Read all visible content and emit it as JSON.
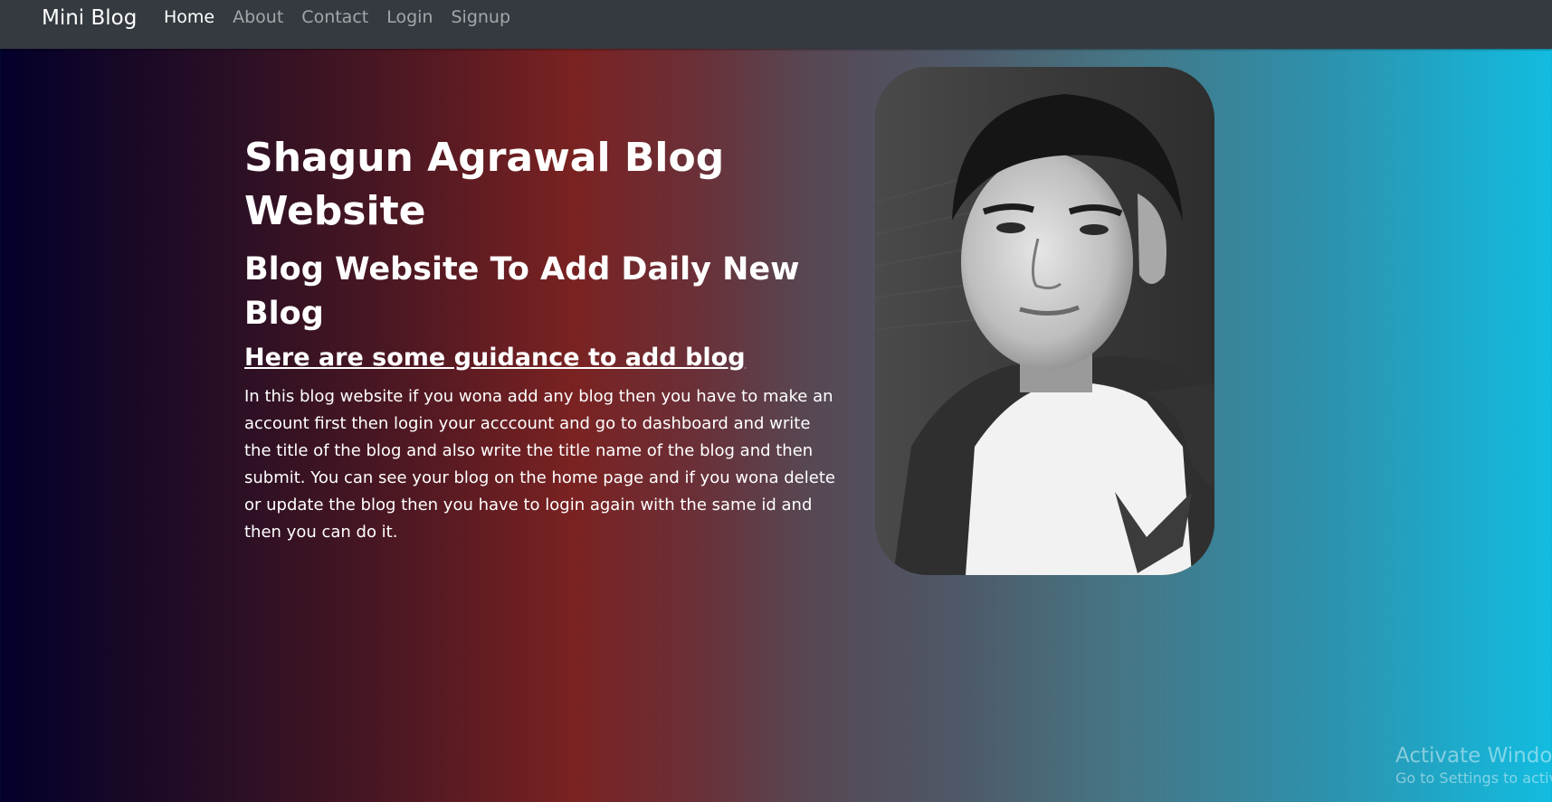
{
  "navbar": {
    "brand": "Mini Blog",
    "links": [
      {
        "label": "Home",
        "active": true
      },
      {
        "label": "About",
        "active": false
      },
      {
        "label": "Contact",
        "active": false
      },
      {
        "label": "Login",
        "active": false
      },
      {
        "label": "Signup",
        "active": false
      }
    ]
  },
  "hero": {
    "title": "Shagun Agrawal Blog Website",
    "subtitle": "Blog Website To Add Daily New Blog",
    "guidance_heading": "Here are some guidance to add blog",
    "guidance_text": "In this blog website if you wona add any blog then you have to make an account first then login your acccount and go to dashboard and write the title of the blog and also write the title name of the blog and then submit. You can see your blog on the home page and if you wona delete or update the blog then you have to login again with the same id and then you can do it."
  },
  "watermark": {
    "title": "Activate Window",
    "subtitle": "Go to Settings to activ"
  },
  "colors": {
    "navbar_bg": "#343a40",
    "gradient_start": "#03002a",
    "gradient_mid": "#7a2222",
    "gradient_end": "#12bce0"
  }
}
